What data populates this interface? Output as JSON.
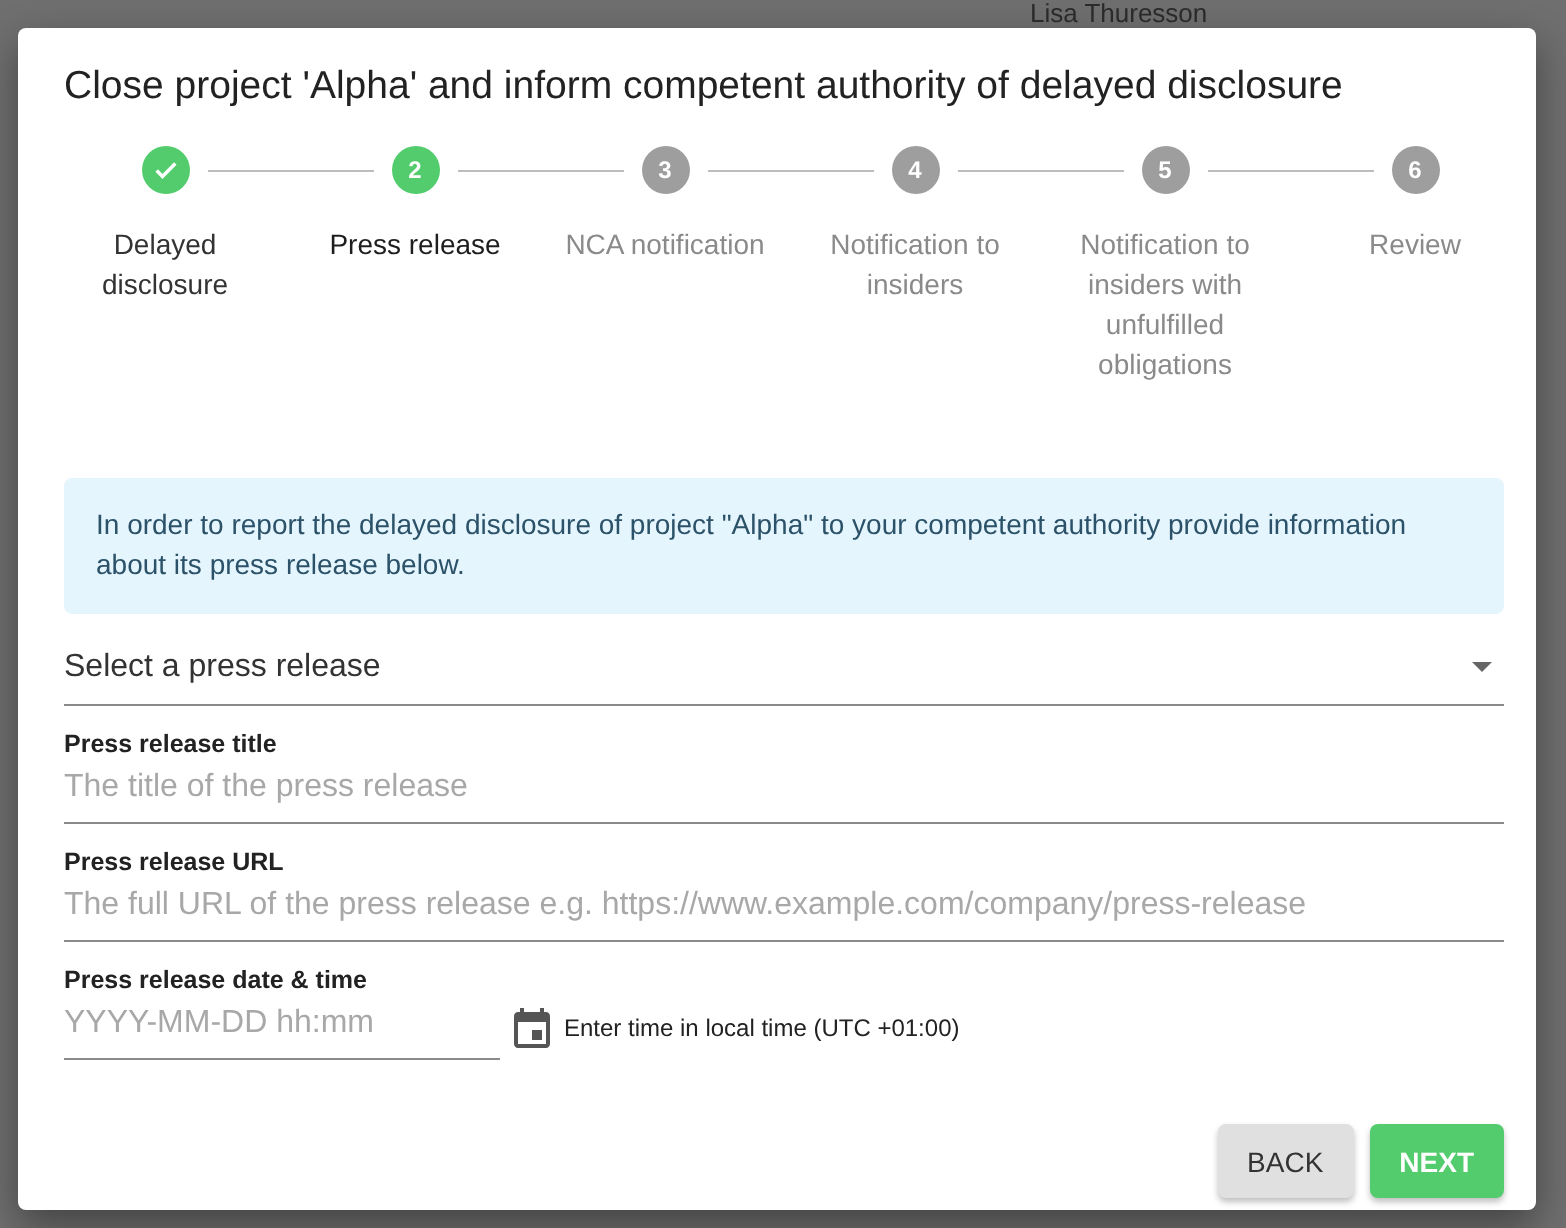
{
  "background": {
    "user_name": "Lisa Thuresson"
  },
  "dialog": {
    "title": "Close project 'Alpha' and inform competent authority of delayed disclosure",
    "steps": [
      {
        "label": "Delayed disclosure",
        "completed": true,
        "selected": false
      },
      {
        "number": "2",
        "label": "Press release",
        "completed": false,
        "selected": true
      },
      {
        "number": "3",
        "label": "NCA notification",
        "completed": false,
        "selected": false
      },
      {
        "number": "4",
        "label": "Notification to insiders",
        "completed": false,
        "selected": false
      },
      {
        "number": "5",
        "label": "Notification to insiders with unfulfilled obligations",
        "completed": false,
        "selected": false
      },
      {
        "number": "6",
        "label": "Review",
        "completed": false,
        "selected": false
      }
    ],
    "info": "In order to report the delayed disclosure of project \"Alpha\" to your competent authority provide information about its press release below.",
    "select": {
      "placeholder": "Select a press release"
    },
    "fields": [
      {
        "label": "Press release title",
        "placeholder": "The title of the press release"
      },
      {
        "label": "Press release URL",
        "placeholder": "The full URL of the press release e.g. https://www.example.com/company/press-release"
      }
    ],
    "datetime": {
      "label": "Press release date & time",
      "placeholder": "YYYY-MM-DD hh:mm",
      "hint": "Enter time in local time (UTC +01:00)"
    },
    "buttons": [
      {
        "label": "BACK",
        "kind": "secondary"
      },
      {
        "label": "NEXT",
        "kind": "primary"
      }
    ]
  }
}
